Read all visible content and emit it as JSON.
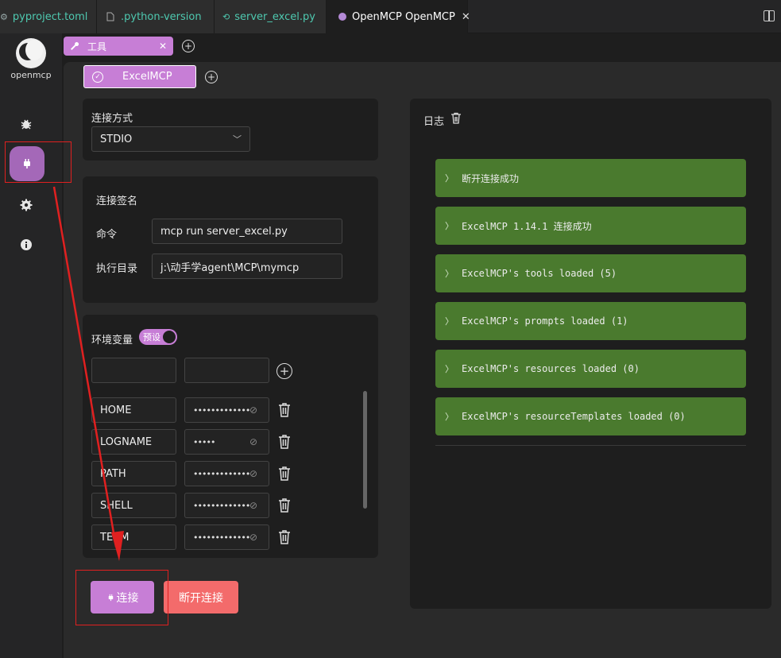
{
  "editor_tabs": [
    {
      "label": "pyproject.toml"
    },
    {
      "label": ".python-version"
    },
    {
      "label": "server_excel.py"
    },
    {
      "label": "OpenMCP OpenMCP",
      "close": "✕"
    }
  ],
  "app": {
    "name": "openmcp"
  },
  "tool_tab": {
    "label": "工具",
    "close": "✕"
  },
  "server_tab": {
    "label": "ExcelMCP"
  },
  "connection": {
    "method_label": "连接方式",
    "method_value": "STDIO",
    "signature_label": "连接签名",
    "command_label": "命令",
    "command_value": "mcp run server_excel.py",
    "cwd_label": "执行目录",
    "cwd_value": "j:\\动手学agent\\MCP\\mymcp"
  },
  "env": {
    "label": "环境变量",
    "preset_label": "预设",
    "rows": [
      {
        "key": "HOME",
        "value": "•••••••••••••"
      },
      {
        "key": "LOGNAME",
        "value": "•••••"
      },
      {
        "key": "PATH",
        "value": "•••••••••••••"
      },
      {
        "key": "SHELL",
        "value": "•••••••••••••"
      },
      {
        "key": "TERM",
        "value": "•••••••••••••"
      }
    ]
  },
  "buttons": {
    "connect": "连接",
    "disconnect": "断开连接"
  },
  "log": {
    "title": "日志",
    "items": [
      "断开连接成功",
      "ExcelMCP 1.14.1 连接成功",
      "ExcelMCP's tools loaded (5)",
      "ExcelMCP's prompts loaded (1)",
      "ExcelMCP's resources loaded (0)",
      "ExcelMCP's resourceTemplates loaded (0)"
    ]
  },
  "colors": {
    "accent": "#c77ed6",
    "danger": "#f36b6b",
    "log_success": "#4a7a2e",
    "annotation": "#e02020"
  }
}
